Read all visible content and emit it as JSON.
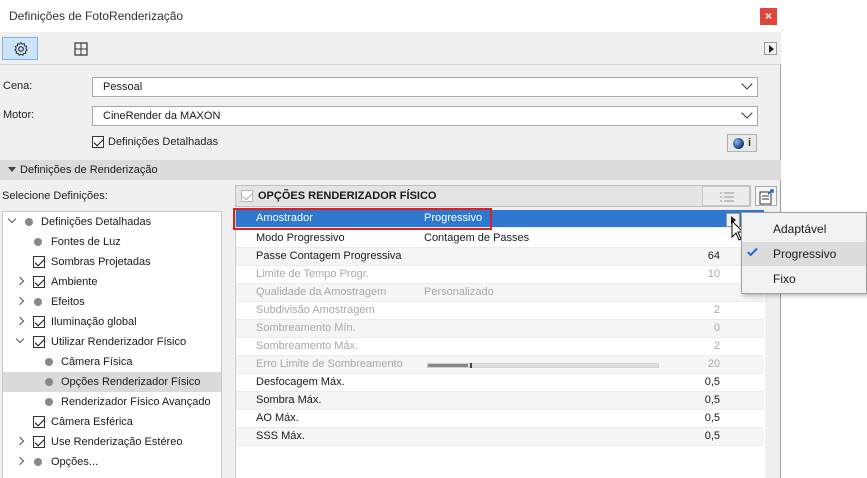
{
  "window": {
    "title": "Definições de FotoRenderização",
    "close_glyph": "×"
  },
  "toolbar": {
    "icons": [
      "gear-icon",
      "layout-grid-icon"
    ],
    "more_icon": "triangle-right-icon"
  },
  "form": {
    "scene_label": "Cena:",
    "scene_value": "Pessoal",
    "engine_label": "Motor:",
    "engine_value": "CineRender da MAXON",
    "detailed_label": "Definições Detalhadas",
    "detailed_checked": true,
    "info_glyph": "i"
  },
  "section": {
    "title": "Definições de Renderização"
  },
  "tree": {
    "title": "Selecione Definições:",
    "items": [
      {
        "label": "Definições Detalhadas"
      },
      {
        "label": "Fontes de Luz"
      },
      {
        "label": "Sombras Projetadas"
      },
      {
        "label": "Ambiente"
      },
      {
        "label": "Efeitos"
      },
      {
        "label": "Iluminação global"
      },
      {
        "label": "Utilizar Renderizador Físico"
      },
      {
        "label": "Câmera Física"
      },
      {
        "label": "Opções Renderizador Físico"
      },
      {
        "label": "Renderizador Físico Avançado"
      },
      {
        "label": "Câmera Esférica"
      },
      {
        "label": "Use Renderização Estéreo"
      },
      {
        "label": "Opções..."
      }
    ]
  },
  "panel": {
    "title": "OPÇÕES RENDERIZADOR FÍSICO",
    "rows": [
      {
        "key": "Amostrador",
        "value": "Progressivo",
        "num": ""
      },
      {
        "key": "Modo Progressivo",
        "value": "Contagem de Passes",
        "num": ""
      },
      {
        "key": "Passe Contagem Progressiva",
        "value": "",
        "num": "64"
      },
      {
        "key": "Limite de Tempo Progr.",
        "value": "",
        "num": "10"
      },
      {
        "key": "Qualidade da Amostragem",
        "value": "Personalizado",
        "num": ""
      },
      {
        "key": "Subdivisão Amostragem",
        "value": "",
        "num": "2"
      },
      {
        "key": "Sombreamento Mín.",
        "value": "",
        "num": "0"
      },
      {
        "key": "Sombreamento Máx.",
        "value": "",
        "num": "2"
      },
      {
        "key": "Erro Limite de Sombreamento",
        "value": "",
        "num": "20"
      },
      {
        "key": "Desfocagem Máx.",
        "value": "",
        "num": "0,5"
      },
      {
        "key": "Sombra Máx.",
        "value": "",
        "num": "0,5"
      },
      {
        "key": "AO Máx.",
        "value": "",
        "num": "0,5"
      },
      {
        "key": "SSS Máx.",
        "value": "",
        "num": "0,5"
      }
    ]
  },
  "popup": {
    "options": [
      {
        "label": "Adaptável"
      },
      {
        "label": "Progressivo"
      },
      {
        "label": "Fixo"
      }
    ],
    "selected": "Progressivo"
  },
  "colors": {
    "highlight": "#2f78d0",
    "close": "#e0443a",
    "callout": "#e02020",
    "check": "#1a6ad0"
  }
}
